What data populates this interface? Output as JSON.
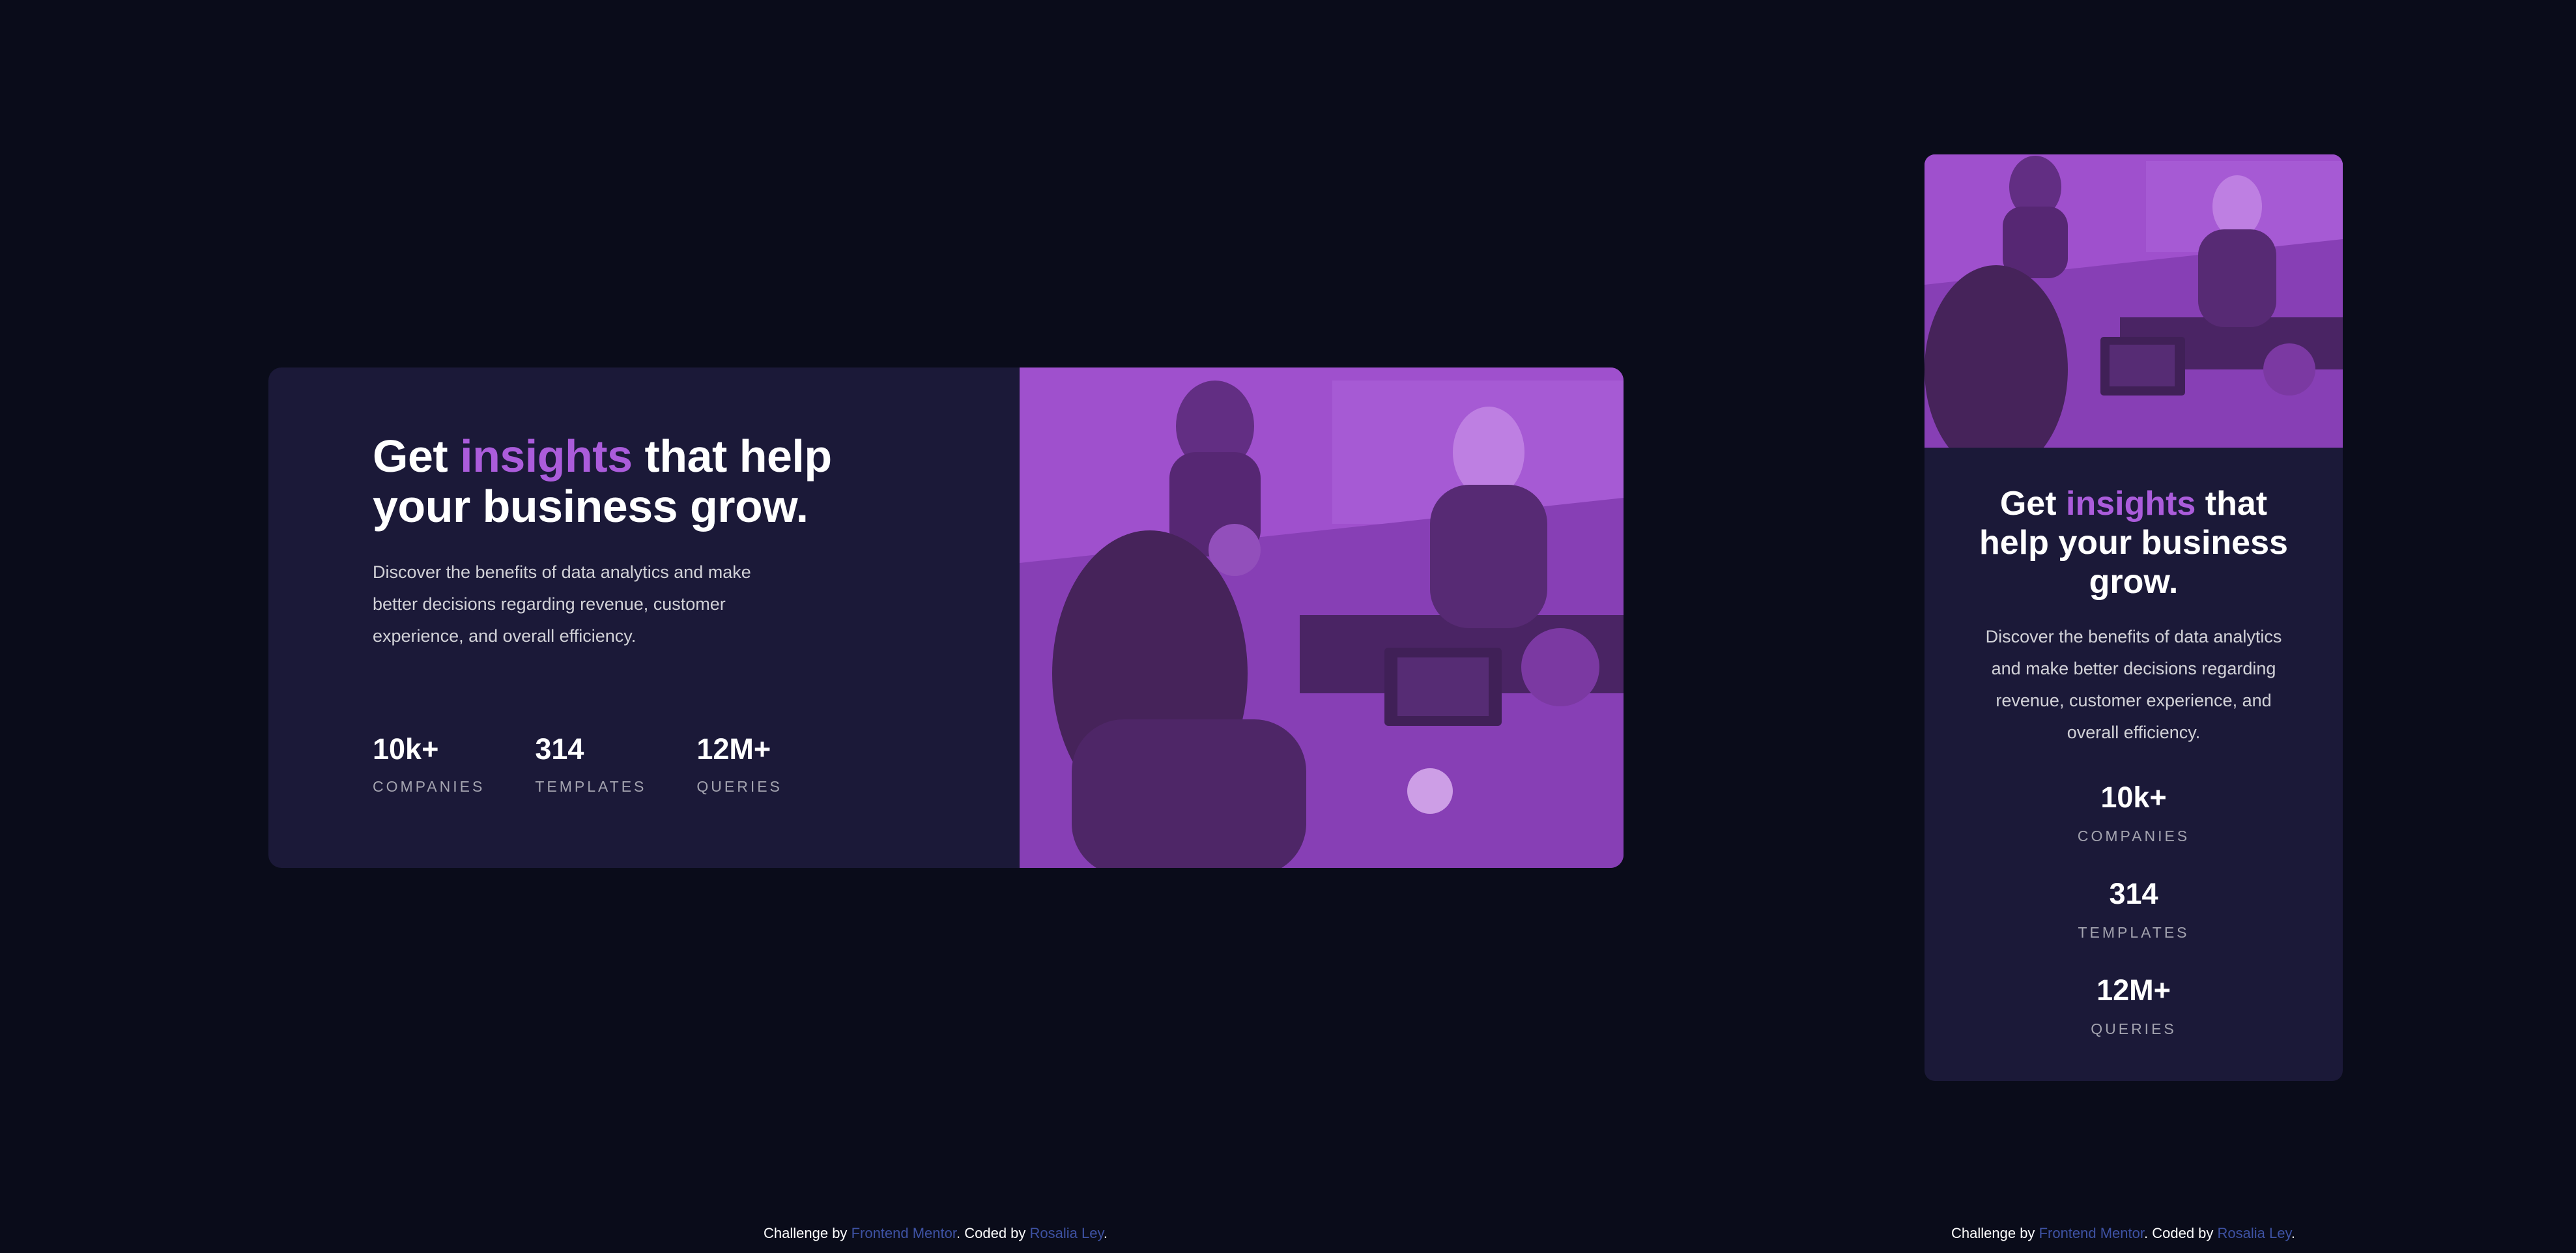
{
  "card": {
    "title_before": "Get",
    "title_accent": "insights",
    "title_after": "that help your business grow.",
    "description": "Discover the benefits of data analytics and make better decisions regarding revenue, customer experience, and overall efficiency.",
    "stats": [
      {
        "value": "10k+",
        "label": "Companies"
      },
      {
        "value": "314",
        "label": "Templates"
      },
      {
        "value": "12M+",
        "label": "Queries"
      }
    ],
    "image_icon": "office-photo-purple-overlay"
  },
  "attribution": {
    "challenge_by": "Challenge by",
    "frontend_mentor": "Frontend Mentor",
    "coded_by": ". Coded by",
    "author": "Rosalia Ley",
    "end": "."
  },
  "colors": {
    "page_bg": "#0a0c1a",
    "card_bg": "#1b1938",
    "accent": "#ab5cdb",
    "link": "#3e52a3",
    "overlay": "#aa5cdb"
  }
}
